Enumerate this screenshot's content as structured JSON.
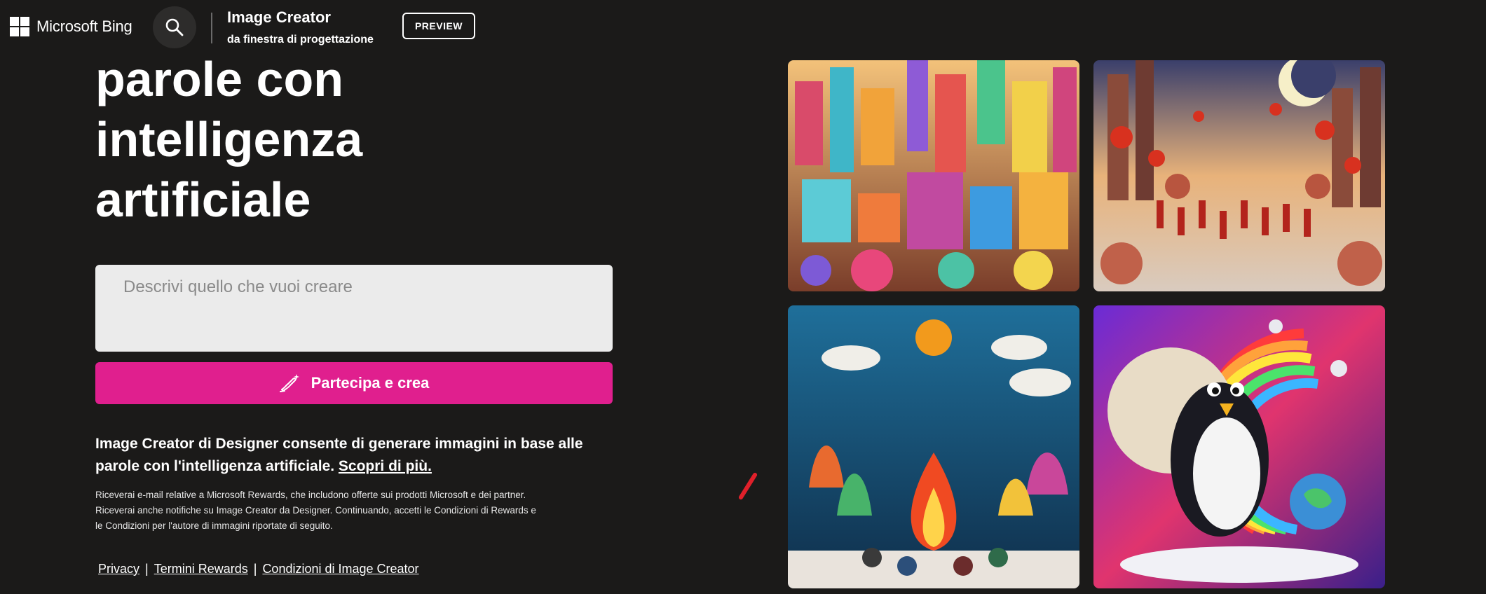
{
  "header": {
    "brand": "Microsoft Bing",
    "app_title": "Image Creator",
    "app_subtitle": "da finestra di progettazione",
    "badge": "PREVIEW"
  },
  "hero": {
    "lines": [
      "parole con",
      "intelligenza",
      "artificiale"
    ]
  },
  "prompt": {
    "placeholder": "Descrivi quello che vuoi creare",
    "value": ""
  },
  "create_button": {
    "label": "Partecipa e crea"
  },
  "description": {
    "text": "Image Creator di Designer consente di generare immagini in base alle parole con l'intelligenza artificiale.",
    "link": "Scopri di più."
  },
  "legal": {
    "text": "Riceverai e-mail relative a Microsoft Rewards, che includono offerte sui prodotti Microsoft e dei partner. Riceverai anche notifiche su Image Creator da Designer. Continuando, accetti le Condizioni di Rewards e le Condizioni per l'autore di immagini riportate di seguito."
  },
  "footer": {
    "links": [
      "Privacy",
      "Termini Rewards",
      "Condizioni di Image Creator"
    ],
    "separator": "|"
  },
  "gallery": {
    "images": [
      "colorful-toy-city",
      "red-lanterns-festival-street",
      "clay-campfire-scene",
      "penguin-on-moon-rainbow"
    ]
  },
  "colors": {
    "background": "#1b1a19",
    "accent": "#e01f8e",
    "input_bg": "#ebebeb"
  }
}
